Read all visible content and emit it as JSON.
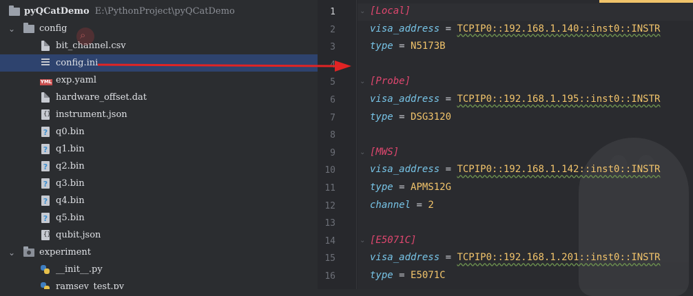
{
  "project": {
    "root_name": "pyQCatDemo",
    "root_path": "E:\\PythonProject\\pyQCatDemo"
  },
  "tree": {
    "items": [
      {
        "label": "config",
        "kind": "folder",
        "expanded": true
      },
      {
        "label": "bit_channel.csv",
        "kind": "file"
      },
      {
        "label": "config.ini",
        "kind": "ini",
        "selected": true
      },
      {
        "label": "exp.yaml",
        "kind": "yaml"
      },
      {
        "label": "hardware_offset.dat",
        "kind": "file"
      },
      {
        "label": "instrument.json",
        "kind": "json"
      },
      {
        "label": "q0.bin",
        "kind": "bin"
      },
      {
        "label": "q1.bin",
        "kind": "bin"
      },
      {
        "label": "q2.bin",
        "kind": "bin"
      },
      {
        "label": "q3.bin",
        "kind": "bin"
      },
      {
        "label": "q4.bin",
        "kind": "bin"
      },
      {
        "label": "q5.bin",
        "kind": "bin"
      },
      {
        "label": "qubit.json",
        "kind": "json"
      },
      {
        "label": "experiment",
        "kind": "folder",
        "expanded": true
      },
      {
        "label": "__init__.py",
        "kind": "py"
      },
      {
        "label": "ramsey_test.py",
        "kind": "py"
      }
    ],
    "yaml_badge": "YML",
    "json_glyph": "{}",
    "bin_glyph": "?"
  },
  "editor": {
    "lines": [
      {
        "n": "1",
        "sec": "[Local]"
      },
      {
        "n": "2",
        "key": "visa_address",
        "eq": " = ",
        "val": "TCPIP0::192.168.1.140::inst0::INSTR"
      },
      {
        "n": "3",
        "key": "type",
        "eq": " = ",
        "val": "N5173B"
      },
      {
        "n": "4"
      },
      {
        "n": "5",
        "sec": "[Probe]"
      },
      {
        "n": "6",
        "key": "visa_address",
        "eq": " = ",
        "val": "TCPIP0::192.168.1.195::inst0::INSTR"
      },
      {
        "n": "7",
        "key": "type",
        "eq": " = ",
        "val": "DSG3120"
      },
      {
        "n": "8"
      },
      {
        "n": "9",
        "sec": "[MWS]"
      },
      {
        "n": "10",
        "key": "visa_address",
        "eq": " = ",
        "val": "TCPIP0::192.168.1.142::inst0::INSTR"
      },
      {
        "n": "11",
        "key": "type",
        "eq": " = ",
        "val": "APMS12G"
      },
      {
        "n": "12",
        "key": "channel",
        "eq": " = ",
        "val": "2"
      },
      {
        "n": "13"
      },
      {
        "n": "14",
        "sec": "[E5071C]"
      },
      {
        "n": "15",
        "key": "visa_address",
        "eq": " = ",
        "val": "TCPIP0::192.168.1.201::inst0::INSTR"
      },
      {
        "n": "16",
        "key": "type",
        "eq": " = ",
        "val": "E5071C"
      }
    ]
  },
  "colors": {
    "annotation_arrow": "#e02424",
    "selection": "#2e436e",
    "section": "#e0476f",
    "key": "#78c5e8",
    "value": "#f2c46b"
  }
}
